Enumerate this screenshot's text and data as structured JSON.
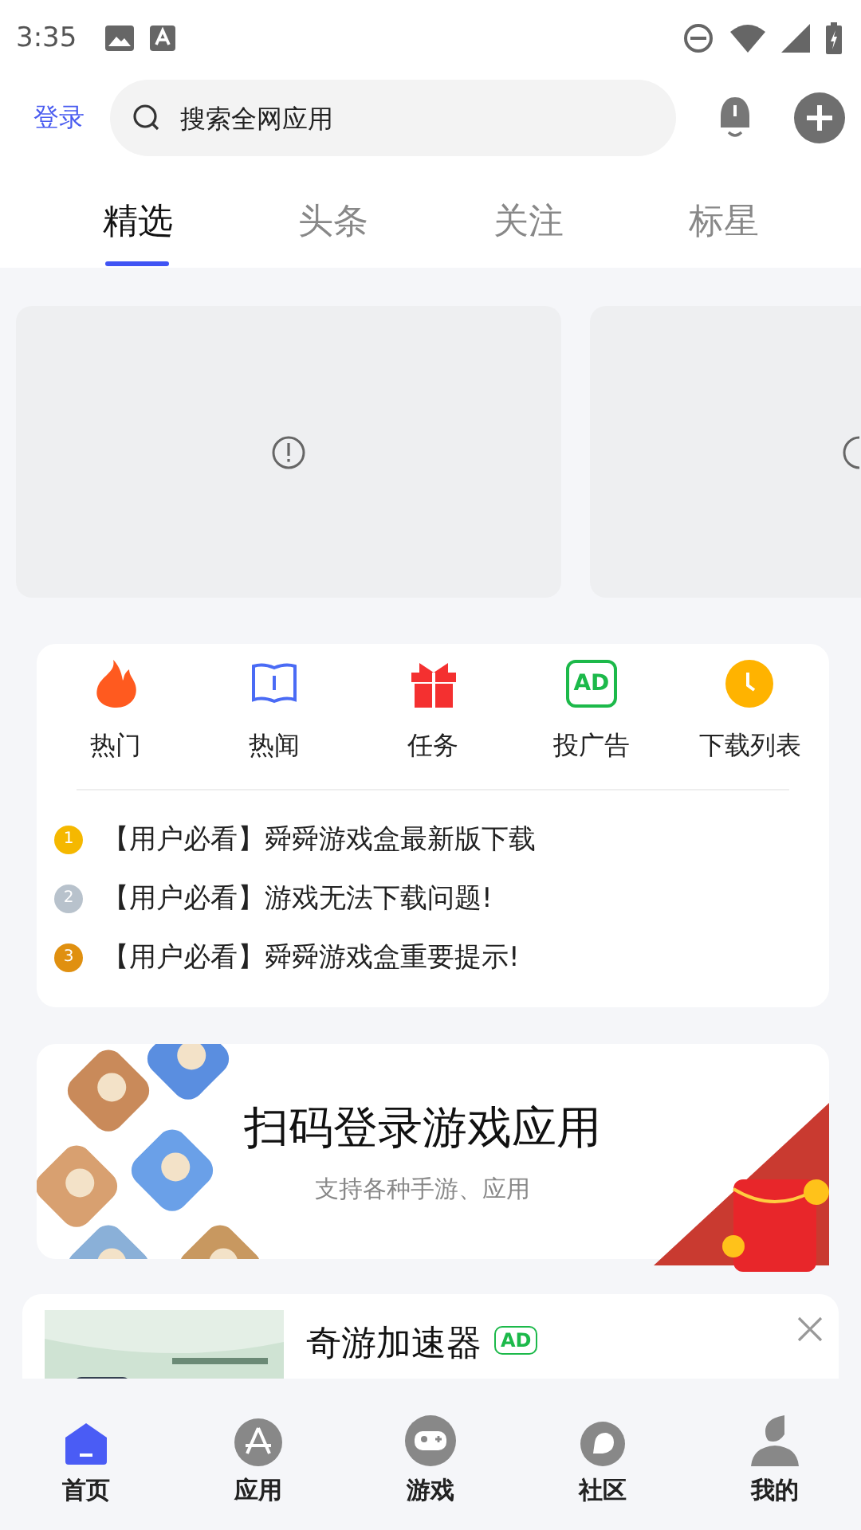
{
  "status_bar": {
    "time": "3:35"
  },
  "header": {
    "login": "登录",
    "search": {
      "placeholder": "搜索全网应用"
    }
  },
  "tabs": [
    {
      "label": "精选",
      "selected": true
    },
    {
      "label": "头条",
      "selected": false
    },
    {
      "label": "关注",
      "selected": false
    },
    {
      "label": "标星",
      "selected": false
    }
  ],
  "quick_menu": [
    {
      "kind": "fire",
      "label": "热门"
    },
    {
      "kind": "book",
      "label": "热闻"
    },
    {
      "kind": "gift",
      "label": "任务"
    },
    {
      "kind": "ad",
      "label": "投广告",
      "icon_text": "AD"
    },
    {
      "kind": "clock",
      "label": "下载列表"
    }
  ],
  "notices": [
    {
      "rank": "1",
      "color": "#f5b800",
      "text": "【用户必看】舜舜游戏盒最新版下载"
    },
    {
      "rank": "2",
      "color": "#b8c2cc",
      "text": "【用户必看】游戏无法下载问题!"
    },
    {
      "rank": "3",
      "color": "#e09010",
      "text": "【用户必看】舜舜游戏盒重要提示!"
    }
  ],
  "scan_banner": {
    "title": "扫码登录游戏应用",
    "subtitle": "支持各种手游、应用"
  },
  "ad_card": {
    "title": "奇游加速器",
    "badge": "AD"
  },
  "bottom_nav": [
    {
      "kind": "home",
      "label": "首页",
      "selected": true
    },
    {
      "kind": "apps",
      "label": "应用",
      "selected": false
    },
    {
      "kind": "game",
      "label": "游戏",
      "selected": false
    },
    {
      "kind": "chat",
      "label": "社区",
      "selected": false
    },
    {
      "kind": "user",
      "label": "我的",
      "selected": false
    }
  ]
}
